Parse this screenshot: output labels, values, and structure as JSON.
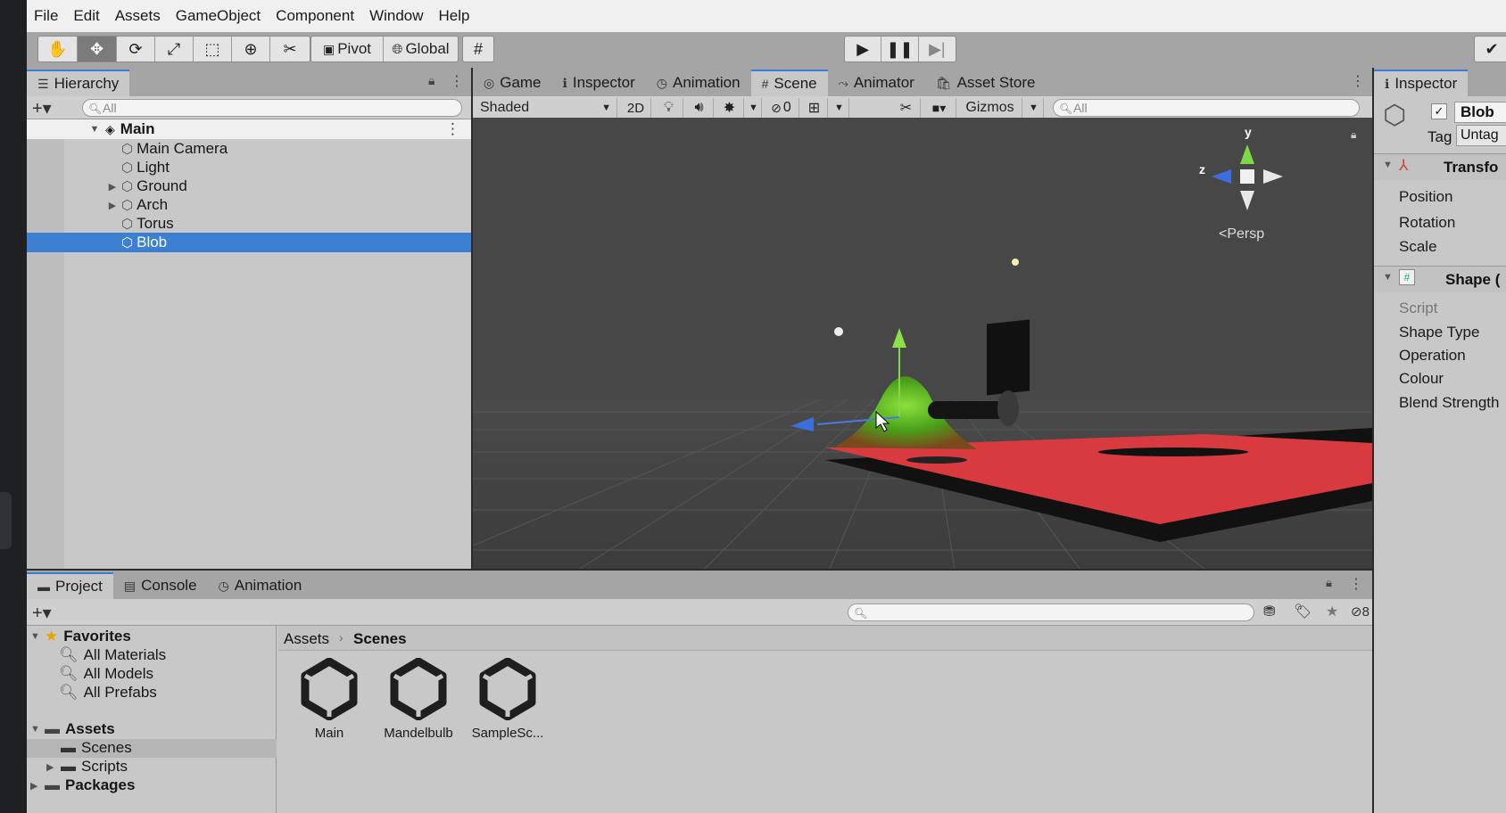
{
  "menubar": [
    "File",
    "Edit",
    "Assets",
    "GameObject",
    "Component",
    "Window",
    "Help"
  ],
  "toolbar": {
    "tools": [
      "hand-icon",
      "move-icon",
      "rotate-icon",
      "scale-icon",
      "rect-icon",
      "transform-icon",
      "custom-tool-icon"
    ],
    "pivot": "Pivot",
    "global": "Global"
  },
  "hierarchy": {
    "tab": "Hierarchy",
    "search_placeholder": "All",
    "scene": "Main",
    "items": [
      {
        "label": "Main Camera",
        "expandable": false
      },
      {
        "label": "Light",
        "expandable": false
      },
      {
        "label": "Ground",
        "expandable": true
      },
      {
        "label": "Arch",
        "expandable": true
      },
      {
        "label": "Torus",
        "expandable": false
      },
      {
        "label": "Blob",
        "expandable": false,
        "selected": true
      }
    ]
  },
  "center_tabs": [
    "Game",
    "Inspector",
    "Animation",
    "Scene",
    "Animator",
    "Asset Store"
  ],
  "scene_toolbar": {
    "shading": "Shaded",
    "mode_2d": "2D",
    "hidden_count": "0",
    "gizmos": "Gizmos",
    "search_placeholder": "All"
  },
  "gizmo": {
    "y": "y",
    "z": "z",
    "persp": "<Persp"
  },
  "inspector": {
    "tab": "Inspector",
    "object_name": "Blob",
    "tag_label": "Tag",
    "tag_value": "Untag",
    "transform_header": "Transfo",
    "transform_props": [
      "Position",
      "Rotation",
      "Scale"
    ],
    "shape_header": "Shape (",
    "shape_props": [
      "Script",
      "Shape Type",
      "Operation",
      "Colour",
      "Blend Strength"
    ]
  },
  "project": {
    "tabs": [
      "Project",
      "Console",
      "Animation"
    ],
    "hidden_count": "8",
    "favorites": "Favorites",
    "favorite_items": [
      "All Materials",
      "All Models",
      "All Prefabs"
    ],
    "assets": "Assets",
    "asset_folders": [
      {
        "label": "Scenes",
        "expandable": false,
        "selected": true
      },
      {
        "label": "Scripts",
        "expandable": true,
        "selected": false
      }
    ],
    "packages": "Packages",
    "breadcrumb": [
      "Assets",
      "Scenes"
    ],
    "files": [
      "Main",
      "Mandelbulb",
      "SampleSc..."
    ]
  },
  "colors": {
    "selection": "#3d7fd0",
    "panel": "#c8c8c8",
    "tabbar": "#a5a5a5",
    "scene_bg": "#474747",
    "ground": "#d83a3f"
  }
}
